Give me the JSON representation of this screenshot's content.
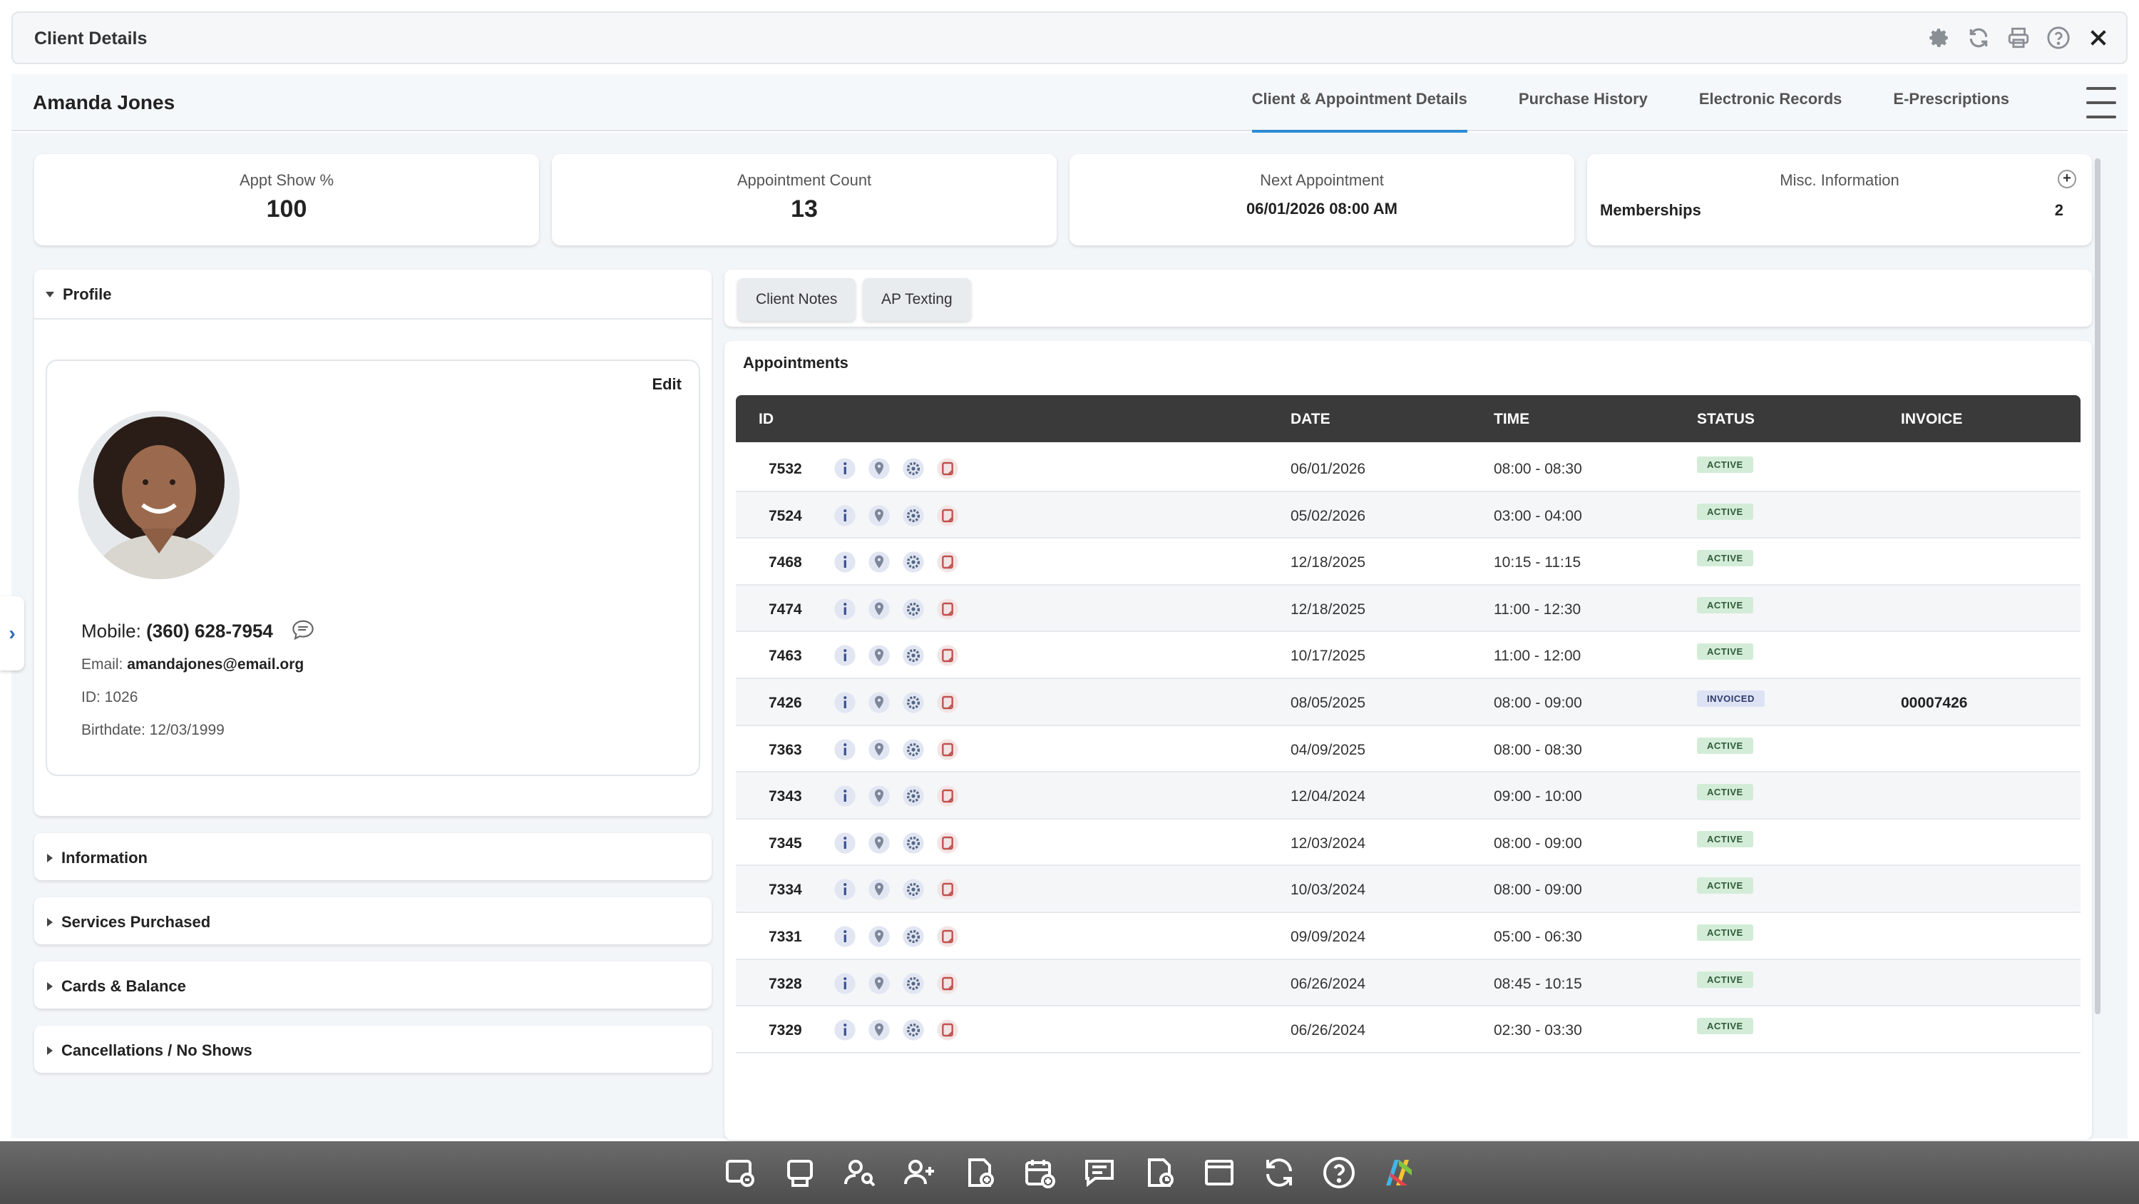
{
  "window": {
    "title": "Client Details",
    "icons": [
      "gear-icon",
      "refresh-icon",
      "print-icon",
      "help-icon",
      "close-icon"
    ]
  },
  "header": {
    "client_name": "Amanda Jones",
    "tabs": [
      {
        "label": "Client & Appointment Details",
        "active": true
      },
      {
        "label": "Purchase History",
        "active": false
      },
      {
        "label": "Electronic Records",
        "active": false
      },
      {
        "label": "E-Prescriptions",
        "active": false
      }
    ]
  },
  "summary": {
    "show_pct": {
      "label": "Appt Show %",
      "value": "100"
    },
    "appt_count": {
      "label": "Appointment Count",
      "value": "13"
    },
    "next_appt": {
      "label": "Next Appointment",
      "value": "06/01/2026 08:00 AM"
    },
    "misc": {
      "label": "Misc. Information",
      "item": "Memberships",
      "count": "2",
      "add": "+"
    }
  },
  "profile": {
    "section_title": "Profile",
    "edit_label": "Edit",
    "mobile_label": "Mobile:",
    "mobile_value": "(360) 628-7954",
    "email_label": "Email:",
    "email_value": "amandajones@email.org",
    "id_line": "ID: 1026",
    "birthdate_line": "Birthdate: 12/03/1999"
  },
  "sections": [
    "Information",
    "Services Purchased",
    "Cards & Balance",
    "Cancellations / No Shows"
  ],
  "side_toggle": "›",
  "buttons": {
    "client_notes": "Client Notes",
    "ap_texting": "AP Texting"
  },
  "appointments": {
    "title": "Appointments",
    "columns": {
      "id": "ID",
      "date": "DATE",
      "time": "TIME",
      "status": "STATUS",
      "invoice": "INVOICE"
    },
    "rows": [
      {
        "id": "7532",
        "date": "06/01/2026",
        "time": "08:00 - 08:30",
        "status": "ACTIVE",
        "invoice": ""
      },
      {
        "id": "7524",
        "date": "05/02/2026",
        "time": "03:00 - 04:00",
        "status": "ACTIVE",
        "invoice": ""
      },
      {
        "id": "7468",
        "date": "12/18/2025",
        "time": "10:15 - 11:15",
        "status": "ACTIVE",
        "invoice": ""
      },
      {
        "id": "7474",
        "date": "12/18/2025",
        "time": "11:00 - 12:30",
        "status": "ACTIVE",
        "invoice": ""
      },
      {
        "id": "7463",
        "date": "10/17/2025",
        "time": "11:00 - 12:00",
        "status": "ACTIVE",
        "invoice": ""
      },
      {
        "id": "7426",
        "date": "08/05/2025",
        "time": "08:00 - 09:00",
        "status": "INVOICED",
        "invoice": "00007426"
      },
      {
        "id": "7363",
        "date": "04/09/2025",
        "time": "08:00 - 08:30",
        "status": "ACTIVE",
        "invoice": ""
      },
      {
        "id": "7343",
        "date": "12/04/2024",
        "time": "09:00 - 10:00",
        "status": "ACTIVE",
        "invoice": ""
      },
      {
        "id": "7345",
        "date": "12/03/2024",
        "time": "08:00 - 09:00",
        "status": "ACTIVE",
        "invoice": ""
      },
      {
        "id": "7334",
        "date": "10/03/2024",
        "time": "08:00 - 09:00",
        "status": "ACTIVE",
        "invoice": ""
      },
      {
        "id": "7331",
        "date": "09/09/2024",
        "time": "05:00 - 06:30",
        "status": "ACTIVE",
        "invoice": ""
      },
      {
        "id": "7328",
        "date": "06/26/2024",
        "time": "08:45 - 10:15",
        "status": "ACTIVE",
        "invoice": ""
      },
      {
        "id": "7329",
        "date": "06/26/2024",
        "time": "02:30 - 03:30",
        "status": "ACTIVE",
        "invoice": ""
      }
    ],
    "row_icons": [
      "info-icon",
      "location-icon",
      "settings-icon",
      "note-icon"
    ]
  },
  "dock": {
    "icons": [
      "checkin-icon",
      "pos-icon",
      "client-search-icon",
      "add-client-icon",
      "add-invoice-icon",
      "add-appointment-icon",
      "messages-icon",
      "schedule-report-icon",
      "window-icon",
      "sync-icon",
      "help-icon",
      "app-logo-icon"
    ]
  },
  "colors": {
    "accent": "#2d8cd6",
    "table_header": "#3a3a3a",
    "active_badge": "#d3ecd8",
    "invoiced_badge": "#dde2f5"
  }
}
